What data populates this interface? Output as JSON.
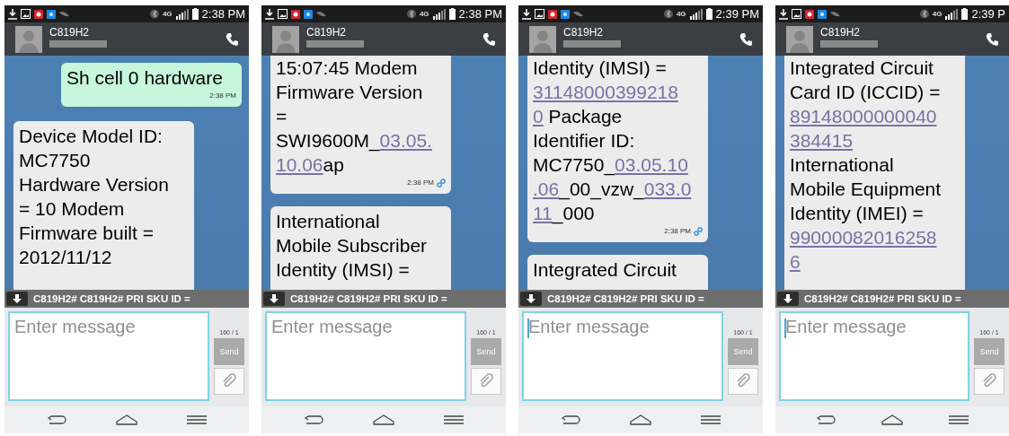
{
  "screens": [
    {
      "status_bar": {
        "network": "4G",
        "time": "2:38 PM"
      },
      "header": {
        "contact": "C819H2"
      },
      "messages": [
        {
          "kind": "sent",
          "cut_top": false,
          "cut_bottom": false,
          "linked": false,
          "time": "2:38 PM",
          "lines": [
            [
              {
                "text": "Sh cell 0 hardware",
                "link": false
              }
            ]
          ]
        },
        {
          "kind": "received",
          "cut_top": false,
          "cut_bottom": true,
          "lines": [
            [
              {
                "text": "Device Model ID:",
                "link": false
              }
            ],
            [
              {
                "text": "MC7750",
                "link": false
              }
            ],
            [
              {
                "text": "Hardware Version",
                "link": false
              }
            ],
            [
              {
                "text": "= 10 Modem",
                "link": false
              }
            ],
            [
              {
                "text": "Firmware built =",
                "link": false
              }
            ],
            [
              {
                "text": "2012/11/12",
                "link": false
              }
            ]
          ]
        }
      ],
      "banner": "C819H2# C819H2# PRI SKU ID =",
      "composer": {
        "placeholder": "Enter message",
        "focused": false,
        "counter": "160 / 1",
        "send": "Send"
      }
    },
    {
      "status_bar": {
        "network": "4G",
        "time": "2:38 PM"
      },
      "header": {
        "contact": "C819H2"
      },
      "messages": [
        {
          "kind": "received",
          "cut_top": true,
          "cut_bottom": false,
          "linked": true,
          "time": "2:38 PM",
          "lines": [
            [
              {
                "text": "15:07:45 Modem",
                "link": false
              }
            ],
            [
              {
                "text": "Firmware Version",
                "link": false
              }
            ],
            [
              {
                "text": "=",
                "link": false
              }
            ],
            [
              {
                "text": "SWI9600M_",
                "link": false
              },
              {
                "text": "03.05.",
                "link": true
              }
            ],
            [
              {
                "text": "10.06",
                "link": true
              },
              {
                "text": "ap",
                "link": false
              }
            ]
          ]
        },
        {
          "kind": "received",
          "cut_top": false,
          "cut_bottom": true,
          "lines": [
            [
              {
                "text": "International",
                "link": false
              }
            ],
            [
              {
                "text": "Mobile Subscriber",
                "link": false
              }
            ],
            [
              {
                "text": "Identity (IMSI) =",
                "link": false
              }
            ]
          ]
        }
      ],
      "banner": "C819H2# C819H2# PRI SKU ID =",
      "composer": {
        "placeholder": "Enter message",
        "focused": false,
        "counter": "160 / 1",
        "send": "Send"
      }
    },
    {
      "status_bar": {
        "network": "4G",
        "time": "2:39 PM"
      },
      "header": {
        "contact": "C819H2"
      },
      "messages": [
        {
          "kind": "received",
          "cut_top": true,
          "cut_bottom": false,
          "linked": true,
          "time": "2:38 PM",
          "lines": [
            [
              {
                "text": "Identity (IMSI) =",
                "link": false
              }
            ],
            [
              {
                "text": "31148000399218",
                "link": true
              }
            ],
            [
              {
                "text": "0",
                "link": true
              },
              {
                "text": " Package",
                "link": false
              }
            ],
            [
              {
                "text": "Identifier ID:",
                "link": false
              }
            ],
            [
              {
                "text": "MC7750_",
                "link": false
              },
              {
                "text": "03.05.10",
                "link": true
              }
            ],
            [
              {
                "text": ".06",
                "link": true
              },
              {
                "text": "_00_vzw_",
                "link": false
              },
              {
                "text": "033.0",
                "link": true
              }
            ],
            [
              {
                "text": "11",
                "link": true
              },
              {
                "text": "_000",
                "link": false
              }
            ]
          ]
        },
        {
          "kind": "received",
          "cut_top": false,
          "cut_bottom": true,
          "lines": [
            [
              {
                "text": "Integrated Circuit",
                "link": false
              }
            ]
          ]
        }
      ],
      "banner": "C819H2# C819H2# PRI SKU ID =",
      "composer": {
        "placeholder": "Enter message",
        "focused": true,
        "counter": "160 / 1",
        "send": "Send"
      }
    },
    {
      "status_bar": {
        "network": "4G",
        "time": "2:39 P"
      },
      "header": {
        "contact": "C819H2"
      },
      "messages": [
        {
          "kind": "received",
          "cut_top": true,
          "cut_bottom": true,
          "lines": [
            [
              {
                "text": "Integrated Circuit",
                "link": false
              }
            ],
            [
              {
                "text": "Card ID (ICCID) =",
                "link": false
              }
            ],
            [
              {
                "text": "89148000000040",
                "link": true
              }
            ],
            [
              {
                "text": "384415",
                "link": true
              }
            ],
            [
              {
                "text": "International",
                "link": false
              }
            ],
            [
              {
                "text": "Mobile Equipment",
                "link": false
              }
            ],
            [
              {
                "text": "Identity (IMEI) =",
                "link": false
              }
            ],
            [
              {
                "text": "99000082016258",
                "link": true
              }
            ],
            [
              {
                "text": "6",
                "link": true
              }
            ]
          ]
        }
      ],
      "banner": "C819H2# C819H2# PRI SKU ID =",
      "composer": {
        "placeholder": "Enter message",
        "focused": true,
        "counter": "160 / 1",
        "send": "Send"
      }
    }
  ]
}
